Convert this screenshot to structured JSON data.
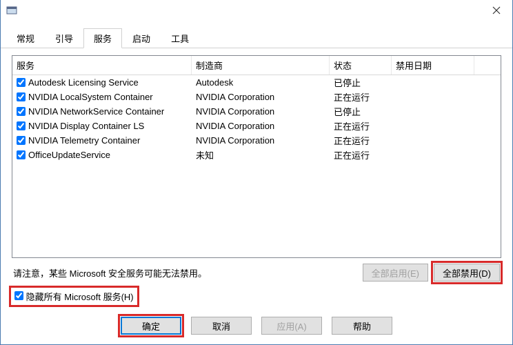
{
  "tabs": {
    "general": "常规",
    "boot": "引导",
    "services": "服务",
    "startup": "启动",
    "tools": "工具"
  },
  "columns": {
    "service": "服务",
    "manufacturer": "制造商",
    "status": "状态",
    "disabled_date": "禁用日期"
  },
  "rows": [
    {
      "checked": true,
      "service": "Autodesk Licensing Service",
      "manufacturer": "Autodesk",
      "status": "已停止"
    },
    {
      "checked": true,
      "service": "NVIDIA LocalSystem Container",
      "manufacturer": "NVIDIA Corporation",
      "status": "正在运行"
    },
    {
      "checked": true,
      "service": "NVIDIA NetworkService Container",
      "manufacturer": "NVIDIA Corporation",
      "status": "已停止"
    },
    {
      "checked": true,
      "service": "NVIDIA Display Container LS",
      "manufacturer": "NVIDIA Corporation",
      "status": "正在运行"
    },
    {
      "checked": true,
      "service": "NVIDIA Telemetry Container",
      "manufacturer": "NVIDIA Corporation",
      "status": "正在运行"
    },
    {
      "checked": true,
      "service": "OfficeUpdateService",
      "manufacturer": "未知",
      "status": "正在运行"
    }
  ],
  "note": "请注意，某些 Microsoft 安全服务可能无法禁用。",
  "buttons": {
    "enable_all": "全部启用(E)",
    "disable_all": "全部禁用(D)",
    "ok": "确定",
    "cancel": "取消",
    "apply": "应用(A)",
    "help": "帮助"
  },
  "hide_ms": "隐藏所有 Microsoft 服务(H)",
  "hide_ms_checked": true,
  "highlights": {
    "color": "#d82a2a"
  }
}
